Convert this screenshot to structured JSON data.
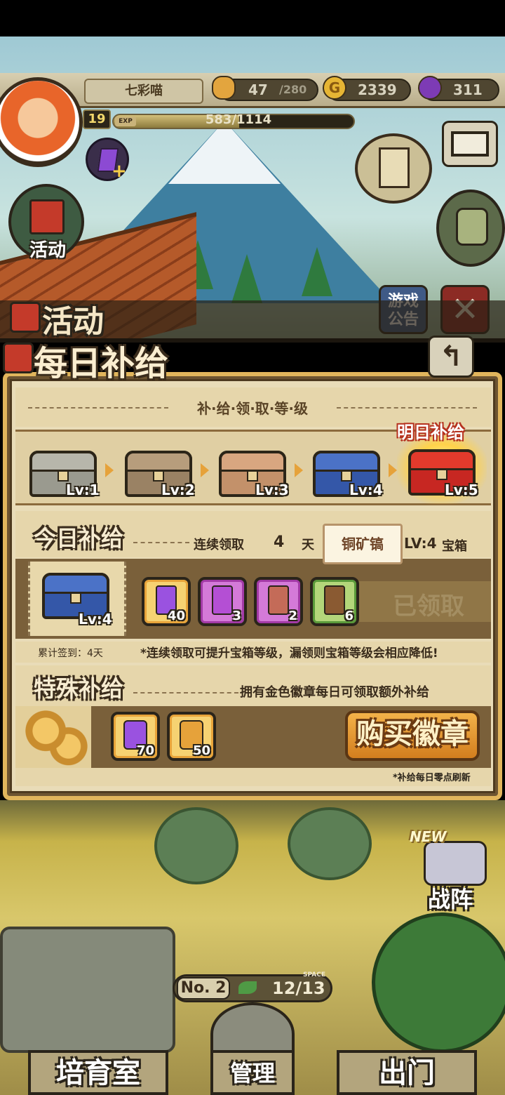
{
  "header": {
    "player_name": "七彩喵",
    "level": "19",
    "exp_tag": "EXP",
    "exp_text": "583/1114",
    "exp_fraction": 0.523,
    "bread_current": "47",
    "bread_max": "/280",
    "gold": "2339",
    "gems": "311"
  },
  "side_buttons": {
    "event_label": "活动",
    "notice_label": "游戏公告"
  },
  "panel": {
    "event_title": "活动",
    "daily_title": "每日补给",
    "level_section_title": "补·给·领·取·等·级",
    "tomorrow_tag": "明日补给",
    "chests": [
      {
        "label": "Lv:1",
        "color": "#9a9a8f",
        "lid": "#b7b6ab"
      },
      {
        "label": "Lv:2",
        "color": "#9a8264",
        "lid": "#b79d7c"
      },
      {
        "label": "Lv:3",
        "color": "#c3916a",
        "lid": "#d8a680"
      },
      {
        "label": "Lv:4",
        "color": "#3457a8",
        "lid": "#4b72c7"
      },
      {
        "label": "Lv:5",
        "color": "#c72722",
        "lid": "#e23a2c"
      }
    ],
    "today": {
      "title": "今日补给",
      "streak_prefix": "连续领取",
      "streak_days": "4",
      "streak_unit": "天",
      "tooltip": "铜矿镐",
      "chest_level": "LV:4",
      "chest_word": "宝箱",
      "chest_label": "Lv:4",
      "items": [
        {
          "icon": "purple-gem-icon",
          "count": "40",
          "border": "#e8a43a",
          "bg": "#f6d272"
        },
        {
          "icon": "potion-icon",
          "count": "3",
          "border": "#a33aa6",
          "bg": "#d47ad8"
        },
        {
          "icon": "ticket-icon",
          "count": "2",
          "border": "#a33aa6",
          "bg": "#d47ad8"
        },
        {
          "icon": "pickaxe-icon",
          "count": "6",
          "border": "#5a9a3a",
          "bg": "#b3d67a"
        }
      ],
      "claimed": "已领取"
    },
    "note_left": "累计签到：4天",
    "note_right": "*连续领取可提升宝箱等级，漏领则宝箱等级会相应降低!",
    "special": {
      "title": "特殊补给",
      "desc": "拥有金色徽章每日可领取额外补给",
      "items": [
        {
          "icon": "purple-gem-icon",
          "count": "70"
        },
        {
          "icon": "bread-icon",
          "count": "50"
        }
      ],
      "buy_button": "购买徽章"
    },
    "refresh_note": "*补给每日零点刷新"
  },
  "lower": {
    "new_tag": "NEW",
    "formation": "战阵",
    "space_no": "No. 2",
    "space_tag": "SPACE",
    "space_count": "12/13"
  },
  "nav": {
    "left": "培育室",
    "center": "管理",
    "right": "出门"
  },
  "colors": {
    "gold_accent": "#e1b55c",
    "panel_bg": "#e9dcb8",
    "panel_dark": "#7a603a"
  }
}
